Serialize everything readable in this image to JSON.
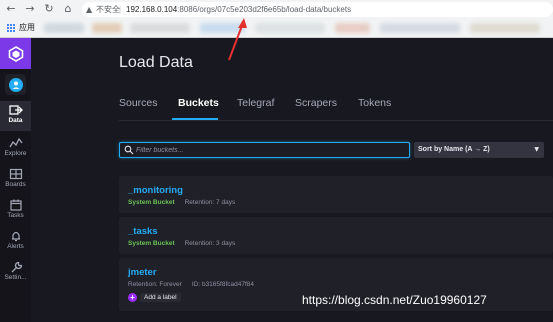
{
  "browser": {
    "insecure_label": "不安全",
    "url_host": "192.168.0.104",
    "url_rest": ":8086/orgs/07c5e203d2f6e65b/load-data/buckets",
    "apps_label": "应用"
  },
  "sidebar": {
    "items": [
      {
        "label": "Data",
        "icon": "data-icon"
      },
      {
        "label": "Explore",
        "icon": "explore-icon"
      },
      {
        "label": "Boards",
        "icon": "boards-icon"
      },
      {
        "label": "Tasks",
        "icon": "tasks-icon"
      },
      {
        "label": "Alerts",
        "icon": "alerts-icon"
      },
      {
        "label": "Settin...",
        "icon": "settings-icon"
      }
    ]
  },
  "page": {
    "title": "Load Data",
    "tabs": [
      "Sources",
      "Buckets",
      "Telegraf",
      "Scrapers",
      "Tokens"
    ],
    "active_tab": "Buckets"
  },
  "filter": {
    "placeholder": "Filter buckets...",
    "sort_label": "Sort by Name (A → Z)"
  },
  "buckets": [
    {
      "name": "_monitoring",
      "type": "System Bucket",
      "retention": "Retention: 7 days"
    },
    {
      "name": "_tasks",
      "type": "System Bucket",
      "retention": "Retention: 3 days"
    },
    {
      "name": "jmeter",
      "retention": "Retention: Forever",
      "id": "ID: b3165f8fcad47f84",
      "add_label": "Add a label"
    }
  ],
  "watermark": "https://blog.csdn.net/Zuo19960127",
  "colors": {
    "accent": "#22adf6",
    "system_bucket": "#6ac255",
    "brand": "#7b39e8",
    "annotation_arrow": "#e53030"
  }
}
